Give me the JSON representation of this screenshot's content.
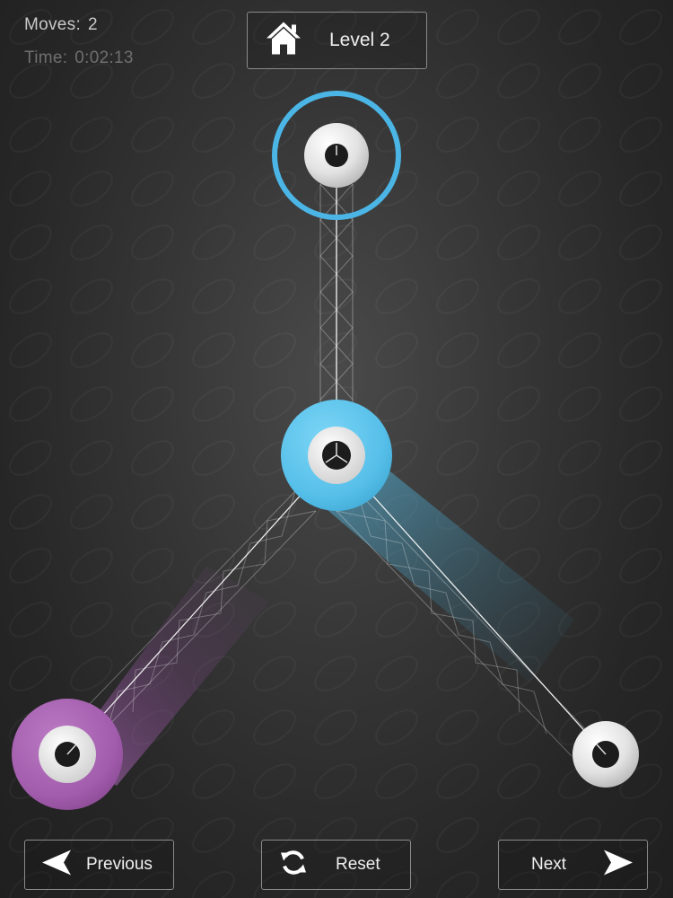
{
  "hud": {
    "moves_label": "Moves:",
    "moves_value": "2",
    "time_label": "Time:",
    "time_value": "0:02:13"
  },
  "header": {
    "level_label": "Level 2",
    "home_icon": "home-icon"
  },
  "controls": {
    "previous_label": "Previous",
    "reset_label": "Reset",
    "next_label": "Next",
    "previous_icon": "arrow-left-icon",
    "reset_icon": "refresh-icon",
    "next_icon": "arrow-right-icon"
  },
  "colors": {
    "background": "#2a2a2a",
    "blue": "#5bc3ec",
    "purple": "#a25dac",
    "white_node": "#e6e6e6",
    "ring": "#4bb6e6",
    "text": "#f0f0f0"
  },
  "board": {
    "nodes": [
      {
        "id": "top",
        "color": "white",
        "selected": true
      },
      {
        "id": "center",
        "color": "blue",
        "selected": false
      },
      {
        "id": "bottom-left",
        "color": "purple",
        "selected": false
      },
      {
        "id": "bottom-right",
        "color": "white",
        "selected": false
      }
    ],
    "links": [
      {
        "from": "top",
        "to": "center",
        "trail": "none"
      },
      {
        "from": "center",
        "to": "bottom-left",
        "trail": "purple"
      },
      {
        "from": "center",
        "to": "bottom-right",
        "trail": "blue"
      }
    ]
  }
}
